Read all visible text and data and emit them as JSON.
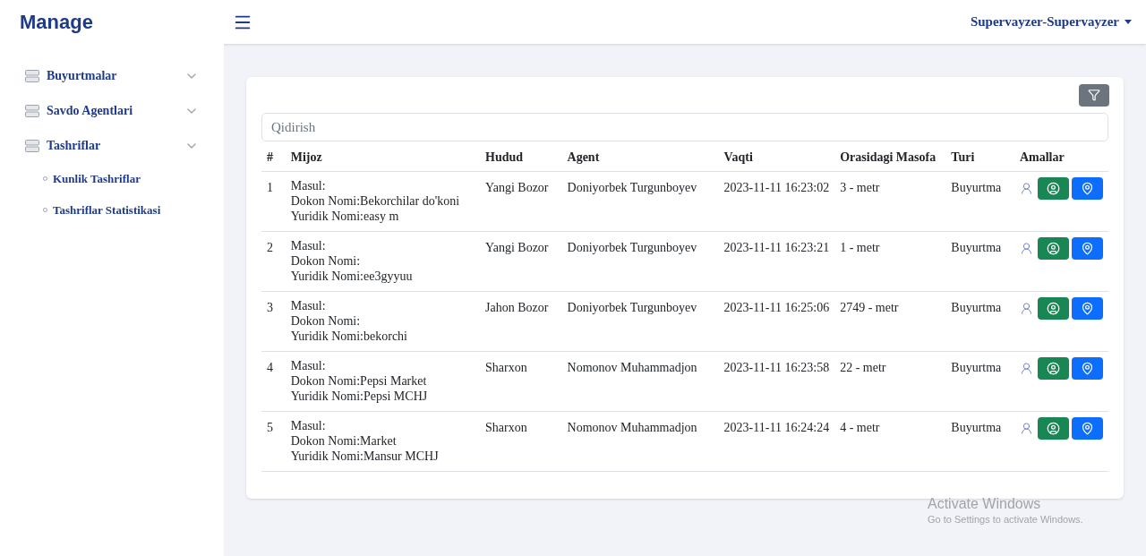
{
  "brand": "Manage",
  "user_menu": {
    "label": "Supervayzer-Supervayzer"
  },
  "sidebar": {
    "items": [
      {
        "label": "Buyurtmalar"
      },
      {
        "label": "Savdo Agentlari"
      },
      {
        "label": "Tashriflar",
        "children": [
          {
            "label": "Kunlik Tashriflar"
          },
          {
            "label": "Tashriflar Statistikasi"
          }
        ]
      }
    ]
  },
  "search": {
    "placeholder": "Qidirish"
  },
  "table": {
    "columns": [
      "#",
      "Mijoz",
      "Hudud",
      "Agent",
      "Vaqti",
      "Orasidagi Masofa",
      "Turi",
      "Amallar"
    ],
    "rows": [
      {
        "num": "1",
        "mijoz": [
          "Masul:",
          "Dokon Nomi:Bekorchilar do'koni",
          "Yuridik Nomi:easy m"
        ],
        "hudud": "Yangi Bozor",
        "agent": "Doniyorbek Turgunboyev",
        "vaqti": "2023-11-11 16:23:02",
        "masofa": "3 - metr",
        "turi": "Buyurtma"
      },
      {
        "num": "2",
        "mijoz": [
          "Masul:",
          "Dokon Nomi:",
          "Yuridik Nomi:ee3gyyuu"
        ],
        "hudud": "Yangi Bozor",
        "agent": "Doniyorbek Turgunboyev",
        "vaqti": "2023-11-11 16:23:21",
        "masofa": "1 - metr",
        "turi": "Buyurtma"
      },
      {
        "num": "3",
        "mijoz": [
          "Masul:",
          "Dokon Nomi:",
          "Yuridik Nomi:bekorchi"
        ],
        "hudud": "Jahon Bozor",
        "agent": "Doniyorbek Turgunboyev",
        "vaqti": "2023-11-11 16:25:06",
        "masofa": "2749 - metr",
        "turi": "Buyurtma"
      },
      {
        "num": "4",
        "mijoz": [
          "Masul:",
          "Dokon Nomi:Pepsi Market",
          "Yuridik Nomi:Pepsi MCHJ"
        ],
        "hudud": "Sharxon",
        "agent": "Nomonov Muhammadjon",
        "vaqti": "2023-11-11 16:23:58",
        "masofa": "22 - metr",
        "turi": "Buyurtma"
      },
      {
        "num": "5",
        "mijoz": [
          "Masul:",
          "Dokon Nomi:Market",
          "Yuridik Nomi:Mansur MCHJ"
        ],
        "hudud": "Sharxon",
        "agent": "Nomonov Muhammadjon",
        "vaqti": "2023-11-11 16:24:24",
        "masofa": "4 - metr",
        "turi": "Buyurtma"
      }
    ]
  },
  "os_notice": {
    "title": "Activate Windows",
    "subtitle": "Go to Settings to activate Windows."
  }
}
